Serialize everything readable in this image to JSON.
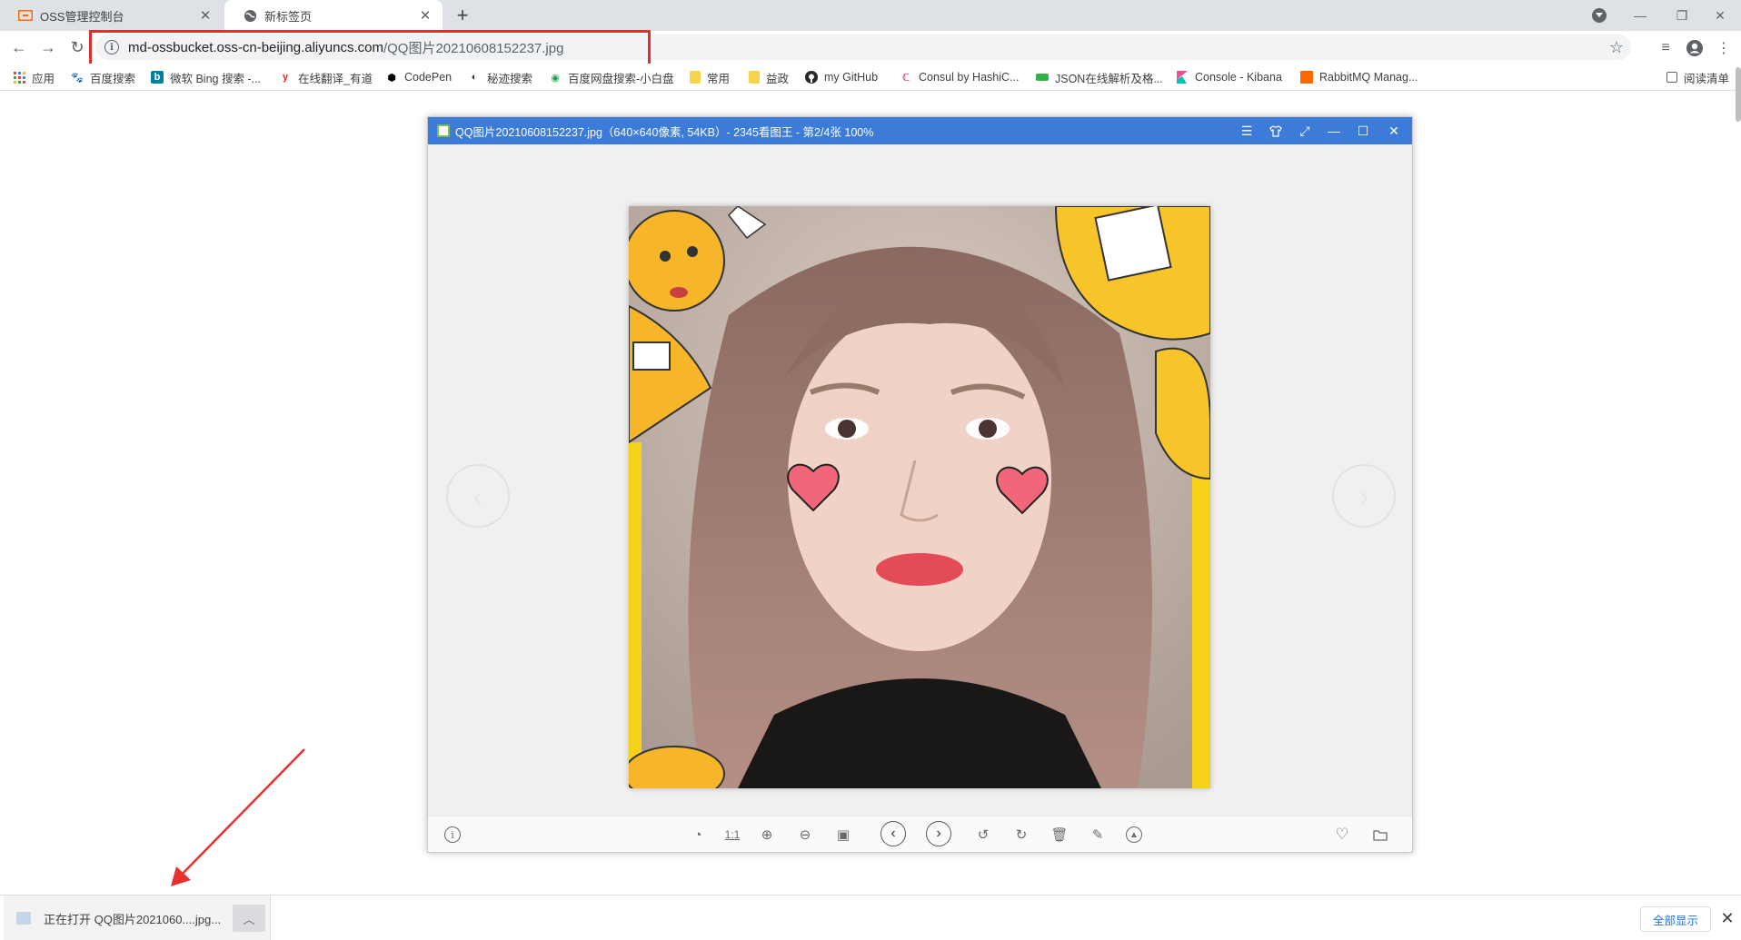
{
  "browser": {
    "tabs": [
      {
        "title": "OSS管理控制台",
        "active": false
      },
      {
        "title": "新标签页",
        "active": true
      }
    ],
    "address": {
      "host": "md-ossbucket.oss-cn-beijing.aliyuncs.com",
      "path": "/QQ图片20210608152237.jpg"
    },
    "bookmarks": [
      {
        "label": "应用",
        "icon": "apps-grid-icon",
        "color": "#e8453c"
      },
      {
        "label": "百度搜索",
        "icon": "baidu-paw-icon",
        "color": "#2932e1"
      },
      {
        "label": "微软 Bing 搜索 -...",
        "icon": "bing-icon",
        "color": "#00809d"
      },
      {
        "label": "在线翻译_有道",
        "icon": "youdao-icon",
        "color": "#e1251b"
      },
      {
        "label": "CodePen",
        "icon": "codepen-icon",
        "color": "#000000"
      },
      {
        "label": "秘迹搜索",
        "icon": "mijisou-icon",
        "color": "#333333"
      },
      {
        "label": "百度网盘搜索-小白盘",
        "icon": "xiaobaipan-icon",
        "color": "#22a34a"
      },
      {
        "label": "常用",
        "icon": "folder-icon",
        "color": "#f5d34a"
      },
      {
        "label": "益政",
        "icon": "folder-icon",
        "color": "#f5d34a"
      },
      {
        "label": "my GitHub",
        "icon": "github-icon",
        "color": "#24292e"
      },
      {
        "label": "Consul by HashiC...",
        "icon": "consul-icon",
        "color": "#ca2171"
      },
      {
        "label": "JSON在线解析及格...",
        "icon": "json-icon",
        "color": "#33b24a"
      },
      {
        "label": "Console - Kibana",
        "icon": "kibana-icon",
        "color": "#e8478b"
      },
      {
        "label": "RabbitMQ Manag...",
        "icon": "rabbitmq-icon",
        "color": "#ff6600"
      }
    ],
    "reading_list": "阅读清单"
  },
  "viewer": {
    "title": "QQ图片20210608152237.jpg（640×640像素, 54KB）- 2345看图王 - 第2/4张 100%",
    "zoom_label": "1:1"
  },
  "download": {
    "item_label": "正在打开 QQ图片2021060....jpg...",
    "show_all": "全部显示"
  },
  "colors": {
    "viewer_titlebar": "#3d7bd9",
    "highlight_box": "#e0302b",
    "arrow": "#e8312f"
  }
}
